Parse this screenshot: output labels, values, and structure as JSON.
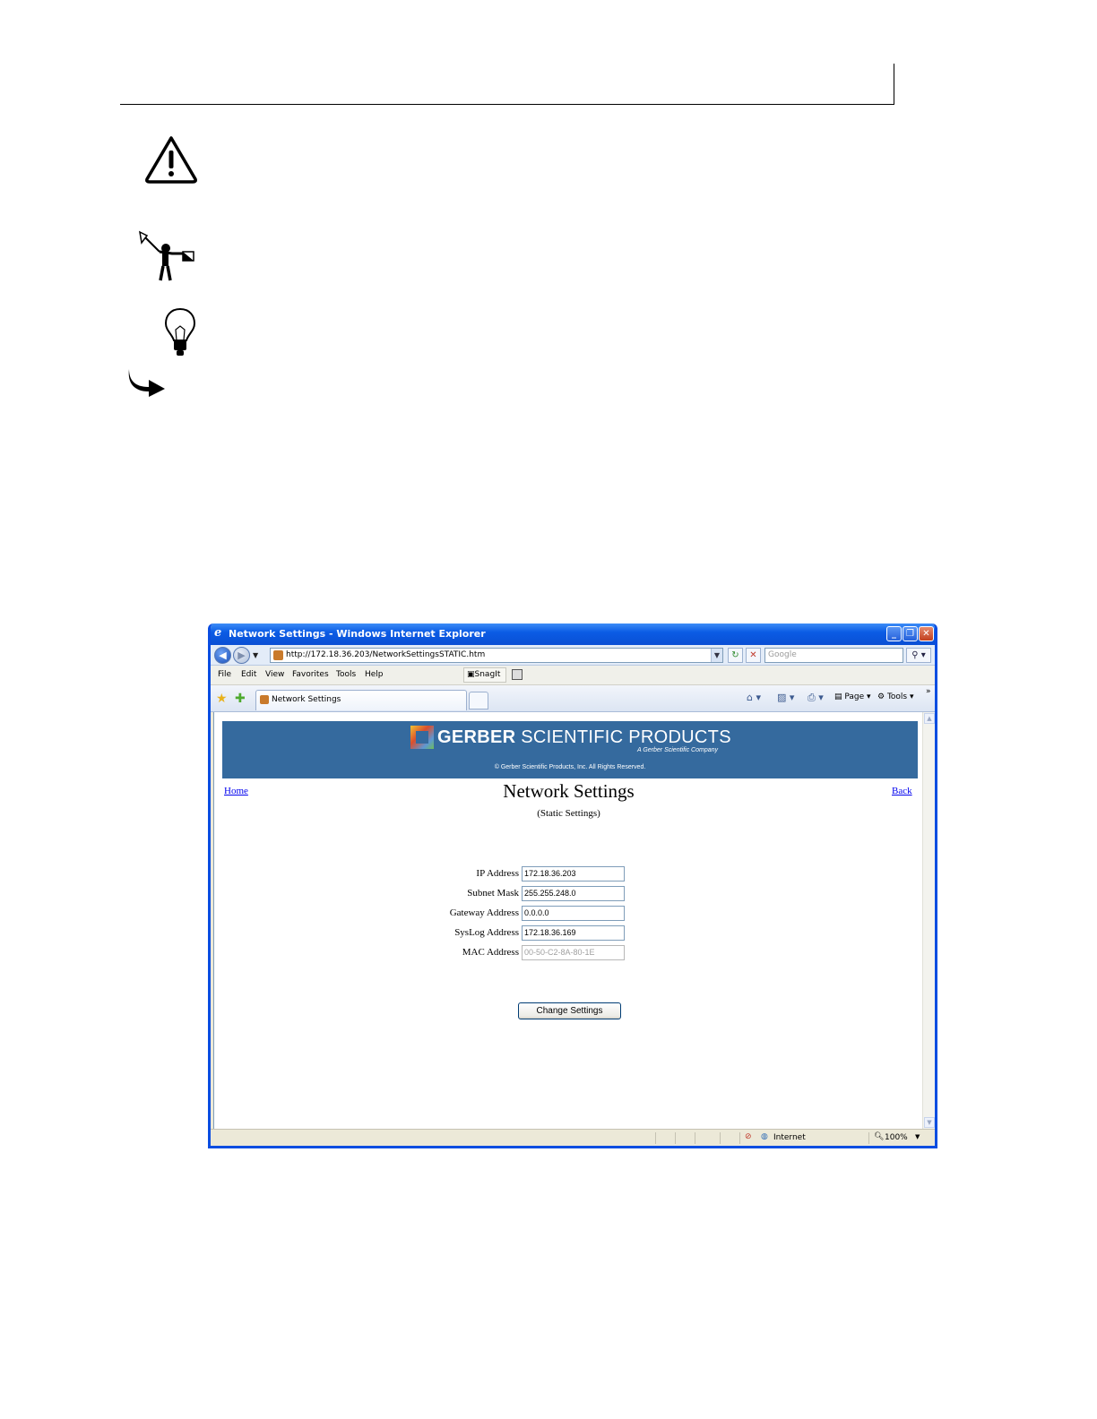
{
  "browser": {
    "title": "Network Settings - Windows Internet Explorer",
    "url": "http://172.18.36.203/NetworkSettingsSTATIC.htm",
    "search_placeholder": "Google",
    "menu": [
      "File",
      "Edit",
      "View",
      "Favorites",
      "Tools",
      "Help"
    ],
    "snagit_label": "SnagIt",
    "tab_label": "Network Settings",
    "commands": {
      "page": "Page",
      "tools": "Tools",
      "more": "»"
    },
    "status": {
      "zone": "Internet",
      "zoom": "100%"
    }
  },
  "banner": {
    "brand_bold": "GERBER",
    "brand_rest": " SCIENTIFIC PRODUCTS",
    "tagline": "A Gerber Scientific Company",
    "copyright": "© Gerber Scientific Products, Inc. All Rights Reserved."
  },
  "page": {
    "home_link": "Home",
    "back_link": "Back",
    "title": "Network Settings",
    "subtitle": "(Static Settings)",
    "fields": [
      {
        "label": "IP Address",
        "value": "172.18.36.203"
      },
      {
        "label": "Subnet Mask",
        "value": "255.255.248.0"
      },
      {
        "label": "Gateway Address",
        "value": "0.0.0.0"
      },
      {
        "label": "SysLog Address",
        "value": "172.18.36.169"
      },
      {
        "label": "MAC Address",
        "value": "00-50-C2-8A-80-1E"
      }
    ],
    "submit_label": "Change Settings"
  },
  "icons": [
    "warning-icon",
    "semaphore-flag-icon",
    "lightbulb-icon",
    "arrow-icon"
  ],
  "colors": {
    "banner": "#356A9E",
    "titlebar": "#0A4FD4",
    "link": "#0000EE"
  }
}
